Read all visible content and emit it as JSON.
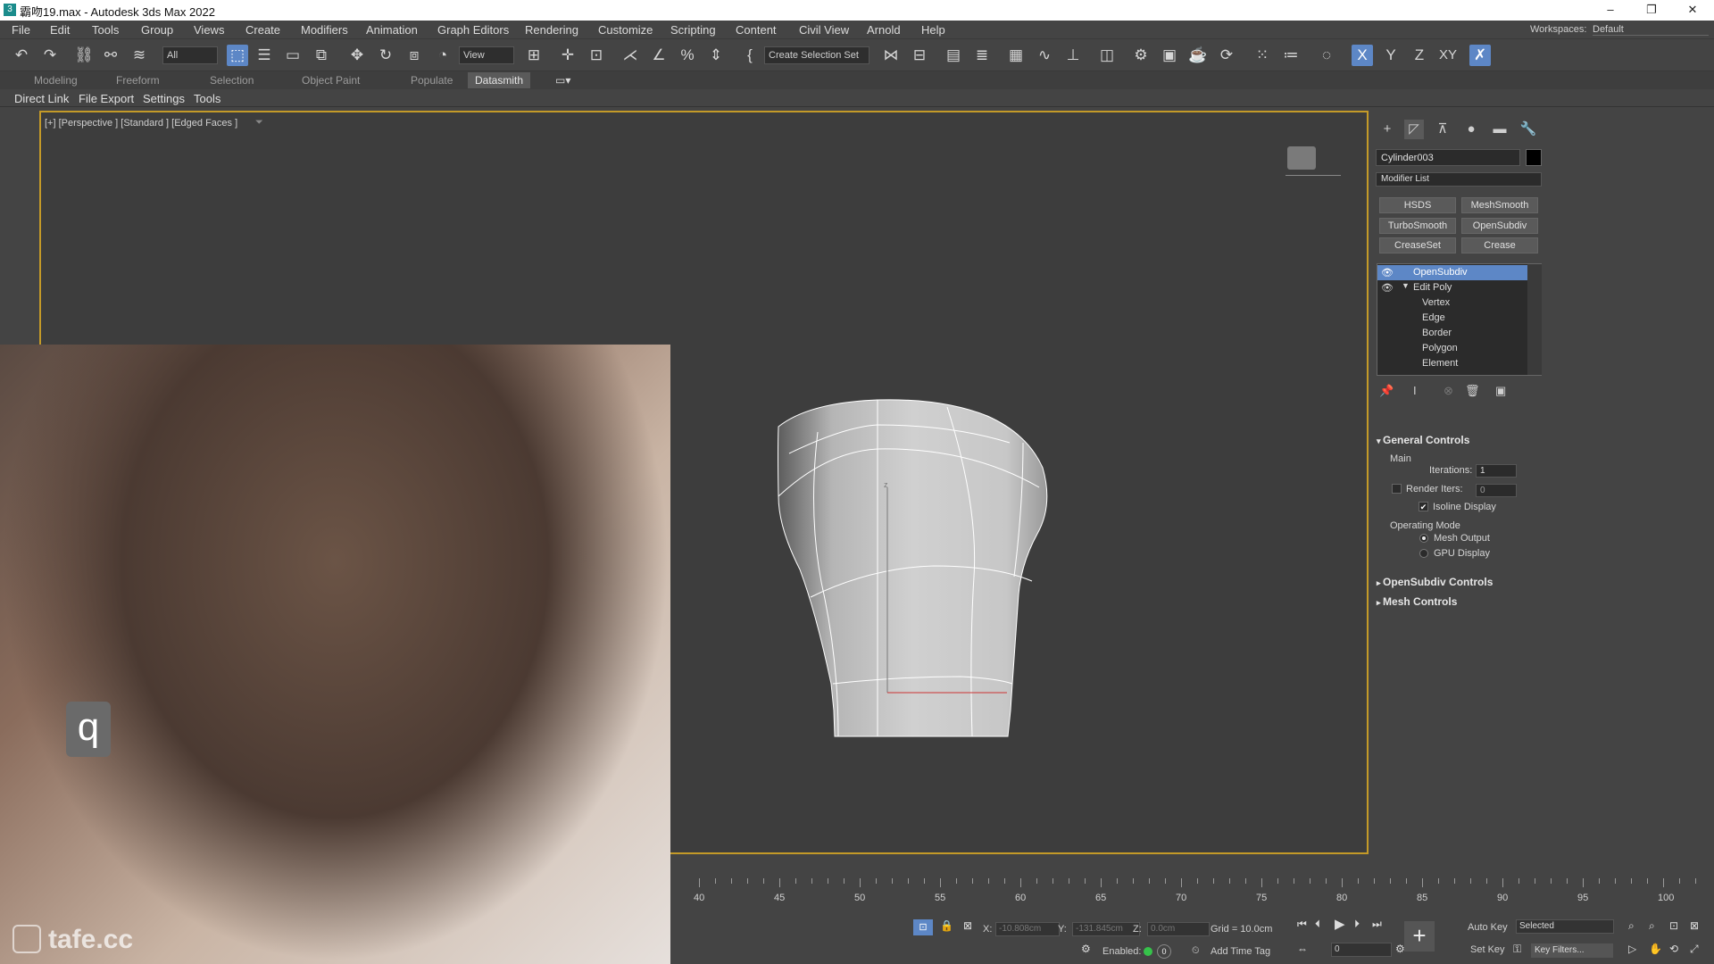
{
  "window": {
    "title": "霸吻19.max - Autodesk 3ds Max 2022",
    "controls": [
      "–",
      "❐",
      "✕"
    ]
  },
  "menu": [
    "File",
    "Edit",
    "Tools",
    "Group",
    "Views",
    "Create",
    "Modifiers",
    "Animation",
    "Graph Editors",
    "Rendering",
    "Customize",
    "Scripting",
    "Content",
    "Civil View",
    "Arnold",
    "Help"
  ],
  "workspace": {
    "label": "Workspaces:",
    "value": "Default"
  },
  "toolbar": {
    "filter_value": "All",
    "refcoord_value": "View",
    "selection_set_value": "Create Selection Set",
    "axis_x": "X",
    "axis_y": "Y",
    "axis_z": "Z",
    "axis_xy": "XY"
  },
  "ribbon": {
    "tabs": [
      "Modeling",
      "Freeform",
      "Selection",
      "Object Paint",
      "Populate",
      "Datasmith"
    ],
    "active": "Datasmith"
  },
  "subbar": [
    "Direct Link",
    "File Export",
    "Settings",
    "Tools"
  ],
  "viewport": {
    "label": "[+] [Perspective ] [Standard ] [Edged Faces ]",
    "gizmo_z": "z"
  },
  "overlay": {
    "letter": "q",
    "watermark": "tafe.cc"
  },
  "command_panel": {
    "object_name": "Cylinder003",
    "object_color": "#000000",
    "modifier_list": "Modifier List",
    "buttons": [
      "HSDS",
      "MeshSmooth",
      "TurboSmooth",
      "OpenSubdiv",
      "CreaseSet",
      "Crease"
    ],
    "stack": [
      "OpenSubdiv",
      "Edit Poly",
      "Vertex",
      "Edge",
      "Border",
      "Polygon",
      "Element"
    ],
    "general_controls": {
      "title": "General Controls",
      "main_label": "Main",
      "iterations_label": "Iterations:",
      "iterations_value": "1",
      "render_iters_label": "Render Iters:",
      "render_iters_value": "0",
      "isoline_label": "Isoline Display",
      "operating_mode_label": "Operating Mode",
      "mesh_output_label": "Mesh Output",
      "gpu_display_label": "GPU Display"
    },
    "rollouts": [
      "OpenSubdiv Controls",
      "Mesh Controls"
    ]
  },
  "timeline": {
    "ticks": [
      "40",
      "45",
      "50",
      "55",
      "60",
      "65",
      "70",
      "75",
      "80",
      "85",
      "90",
      "95",
      "100"
    ]
  },
  "status": {
    "x_label": "X:",
    "x_value": "-10.808cm",
    "y_label": "Y:",
    "y_value": "-131.845cm",
    "z_label": "Z:",
    "z_value": "0.0cm",
    "grid": "Grid = 10.0cm",
    "enabled_label": "Enabled:",
    "enabled_value": "0",
    "add_time_tag": "Add Time Tag",
    "auto_key": "Auto Key",
    "selected": "Selected",
    "set_key": "Set Key",
    "key_filters": "Key Filters...",
    "frame_value": "0"
  }
}
